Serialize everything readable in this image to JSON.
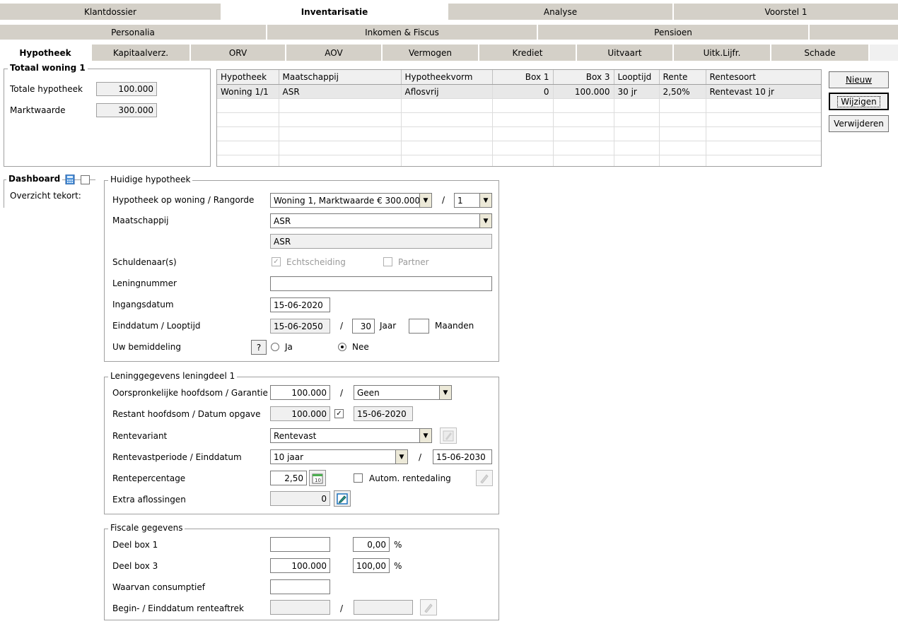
{
  "main_tabs": [
    {
      "label": "Klantdossier",
      "active": false
    },
    {
      "label": "Inventarisatie",
      "active": true
    },
    {
      "label": "Analyse",
      "active": false
    },
    {
      "label": "Voorstel 1",
      "active": false
    }
  ],
  "sub_tabs": [
    "Personalia",
    "Inkomen & Fiscus",
    "Pensioen",
    ""
  ],
  "section_tabs": [
    {
      "label": "Hypotheek",
      "active": true
    },
    {
      "label": "Kapitaalverz.",
      "active": false
    },
    {
      "label": "ORV",
      "active": false
    },
    {
      "label": "AOV",
      "active": false
    },
    {
      "label": "Vermogen",
      "active": false
    },
    {
      "label": "Krediet",
      "active": false
    },
    {
      "label": "Uitvaart",
      "active": false
    },
    {
      "label": "Uitk.Lijfr.",
      "active": false
    },
    {
      "label": "Schade",
      "active": false
    }
  ],
  "totaal": {
    "title": "Totaal woning 1",
    "totale_hypotheek_label": "Totale hypotheek",
    "totale_hypotheek_value": "100.000",
    "marktwaarde_label": "Marktwaarde",
    "marktwaarde_value": "300.000"
  },
  "grid": {
    "columns": [
      "Hypotheek",
      "Maatschappij",
      "Hypotheekvorm",
      "Box 1",
      "Box 3",
      "Looptijd",
      "Rente",
      "Rentesoort"
    ],
    "rows": [
      [
        "Woning 1/1",
        "ASR",
        "Aflosvrij",
        "0",
        "100.000",
        "30 jr",
        "2,50%",
        "Rentevast 10 jr"
      ]
    ]
  },
  "buttons": {
    "nieuw": "Nieuw",
    "wijzigen": "Wijzigen",
    "verwijderen": "Verwijderen"
  },
  "dashboard": {
    "title": "Dashboard",
    "overzicht": "Overzicht tekort:"
  },
  "huidige": {
    "title": "Huidige hypotheek",
    "woning_label": "Hypotheek op woning / Rangorde",
    "woning_value": "Woning 1, Marktwaarde € 300.000",
    "rangorde_sep": "/",
    "rangorde_value": "1",
    "maatschappij_label": "Maatschappij",
    "maatschappij_value": "ASR",
    "maatschappij_display": "ASR",
    "schuldenaar_label": "Schuldenaar(s)",
    "echtscheiding_label": "Echtscheiding",
    "partner_label": "Partner",
    "leningnummer_label": "Leningnummer",
    "leningnummer_value": "",
    "ingangsdatum_label": "Ingangsdatum",
    "ingangsdatum_value": "15-06-2020",
    "einddatum_label": "Einddatum / Looptijd",
    "einddatum_value": "15-06-2050",
    "looptijd_sep": "/",
    "looptijd_value": "30",
    "jaar_label": "Jaar",
    "maanden_value": "",
    "maanden_label": "Maanden",
    "bemiddeling_label": "Uw bemiddeling",
    "help_label": "?",
    "ja_label": "Ja",
    "nee_label": "Nee"
  },
  "leningdeel": {
    "title": "Leninggegevens leningdeel 1",
    "hoofdsom_label": "Oorspronkelijke hoofdsom / Garantie",
    "hoofdsom_value": "100.000",
    "garantie_sep": "/",
    "garantie_value": "Geen",
    "restant_label": "Restant hoofdsom / Datum opgave",
    "restant_value": "100.000",
    "datum_opgave_value": "15-06-2020",
    "rentevariant_label": "Rentevariant",
    "rentevariant_value": "Rentevast",
    "rentevast_label": "Rentevastperiode / Einddatum",
    "rentevast_value": "10 jaar",
    "einddatum_sep": "/",
    "einddatum_value": "15-06-2030",
    "rentepercentage_label": "Rentepercentage",
    "rentepercentage_value": "2,50",
    "autom_label": "Autom. rentedaling",
    "extra_label": "Extra aflossingen",
    "extra_value": "0"
  },
  "fiscaal": {
    "title": "Fiscale gegevens",
    "box1_label": "Deel box 1",
    "box1_value": "",
    "box1_pct": "0,00",
    "box3_label": "Deel box 3",
    "box3_value": "100.000",
    "box3_pct": "100,00",
    "pct_symbol": "%",
    "consumptief_label": "Waarvan consumptief",
    "consumptief_value": "",
    "renteaftrek_label": "Begin- / Einddatum renteaftrek",
    "renteaftrek_sep": "/"
  }
}
